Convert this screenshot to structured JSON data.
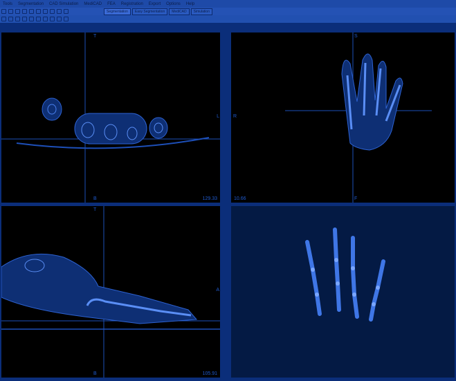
{
  "menu": [
    "Tools",
    "Segmentation",
    "CAD Simulation",
    "MediCAD",
    "FEA",
    "Registration",
    "Export",
    "Options",
    "Help"
  ],
  "tabs": [
    "Segmentation",
    "Easy Segmentation",
    "MediCAD",
    "Simulation"
  ],
  "views": {
    "axial": {
      "top_label": "T",
      "right_label": "L",
      "bottom_label": "B",
      "coord": "129.33"
    },
    "coronal": {
      "left_label": "R",
      "top_label": "S",
      "bottom_label": "F",
      "coord": "10.66"
    },
    "sagittal": {
      "top_label": "T",
      "right_label": "A",
      "bottom_label": "B",
      "coord": "105.91"
    },
    "render3d": {}
  }
}
